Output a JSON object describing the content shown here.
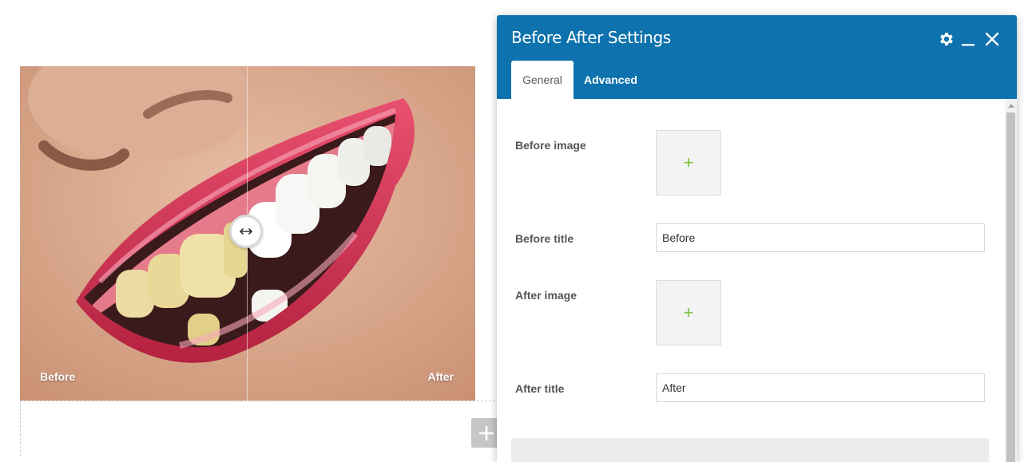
{
  "slider": {
    "before_label": "Before",
    "after_label": "After",
    "handle_icon": "horizontal-arrows-icon",
    "add_icon": "plus-icon"
  },
  "panel": {
    "title": "Before After Settings",
    "header_icons": [
      "gear-icon",
      "minimize-icon",
      "close-icon"
    ],
    "header_color": "#0d72ad",
    "tabs": [
      {
        "label": "General",
        "active": true
      },
      {
        "label": "Advanced",
        "active": false
      }
    ],
    "fields": {
      "before_image_label": "Before image",
      "before_title_label": "Before title",
      "before_title_value": "Before",
      "after_image_label": "After image",
      "after_title_label": "After title",
      "after_title_value": "After"
    },
    "upload_accent": "#7dc142"
  }
}
